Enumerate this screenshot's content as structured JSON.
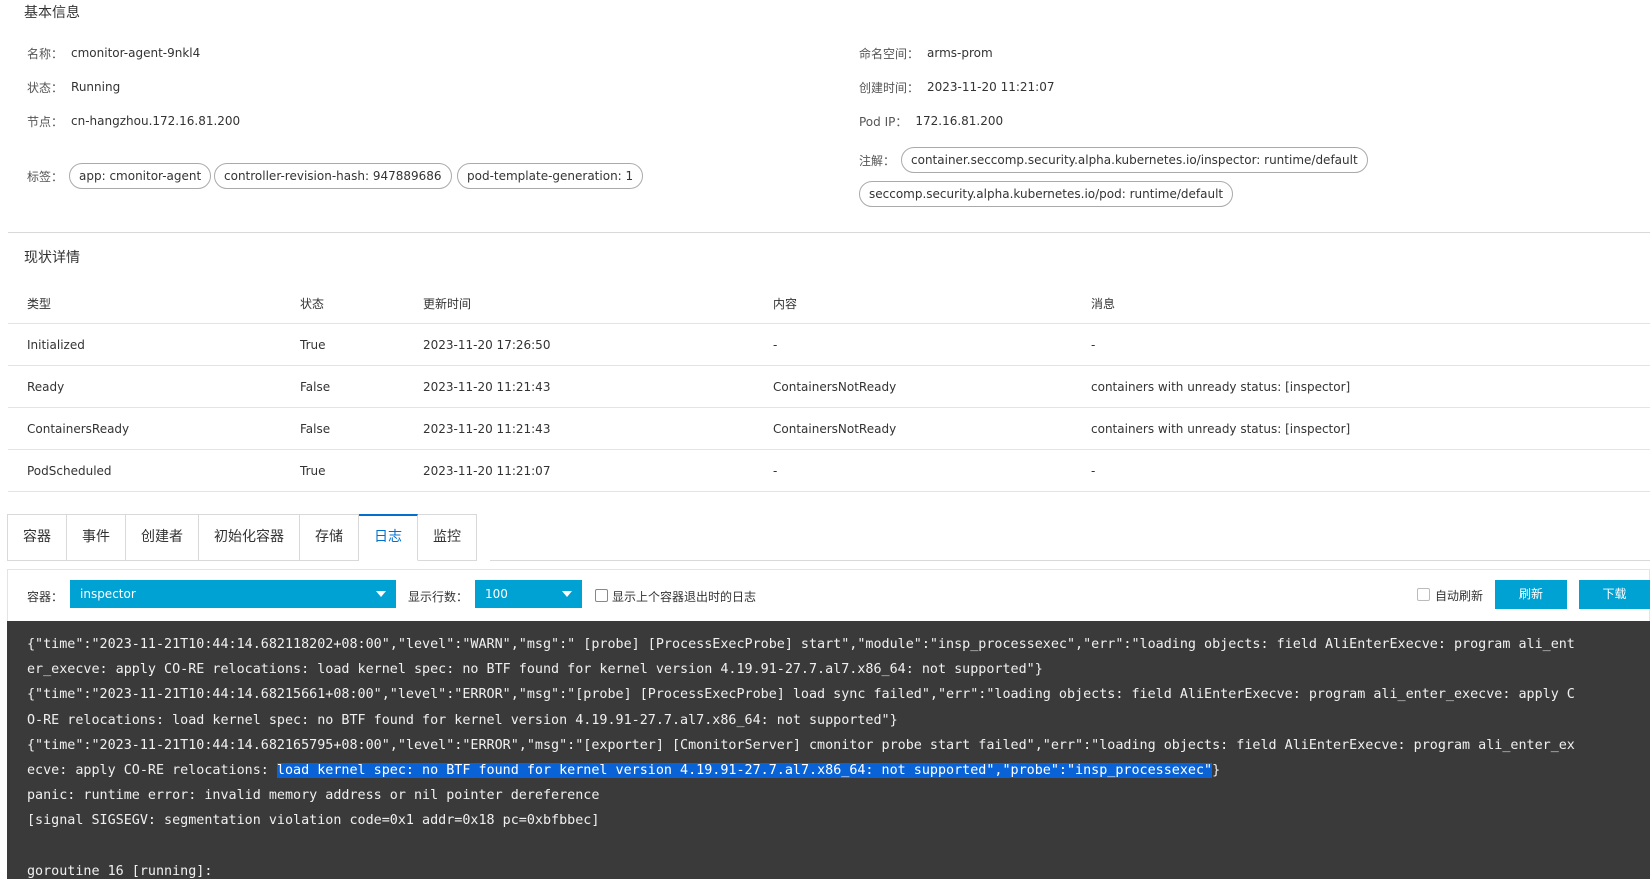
{
  "basic_info": {
    "title": "基本信息",
    "name_label": "名称：",
    "name_value": "cmonitor-agent-9nkl4",
    "namespace_label": "命名空间：",
    "namespace_value": "arms-prom",
    "status_label": "状态：",
    "status_value": "Running",
    "created_label": "创建时间：",
    "created_value": "2023-11-20 11:21:07",
    "node_label": "节点：",
    "node_value": "cn-hangzhou.172.16.81.200",
    "podip_label": "Pod IP：",
    "podip_value": "172.16.81.200",
    "labels_label": "标签：",
    "labels": [
      "app: cmonitor-agent",
      "controller-revision-hash: 947889686",
      "pod-template-generation: 1"
    ],
    "annotations_label": "注解：",
    "annotations": [
      "container.seccomp.security.alpha.kubernetes.io/inspector: runtime/default",
      "seccomp.security.alpha.kubernetes.io/pod: runtime/default"
    ]
  },
  "status_details": {
    "title": "现状详情",
    "columns": [
      "类型",
      "状态",
      "更新时间",
      "内容",
      "消息"
    ],
    "rows": [
      [
        "Initialized",
        "True",
        "2023-11-20 17:26:50",
        "-",
        "-"
      ],
      [
        "Ready",
        "False",
        "2023-11-20 11:21:43",
        "ContainersNotReady",
        "containers with unready status: [inspector]"
      ],
      [
        "ContainersReady",
        "False",
        "2023-11-20 11:21:43",
        "ContainersNotReady",
        "containers with unready status: [inspector]"
      ],
      [
        "PodScheduled",
        "True",
        "2023-11-20 11:21:07",
        "-",
        "-"
      ]
    ]
  },
  "tabs": [
    "容器",
    "事件",
    "创建者",
    "初始化容器",
    "存储",
    "日志",
    "监控"
  ],
  "active_tab": "日志",
  "log_panel": {
    "container_label": "容器：",
    "container_value": "inspector",
    "lines_label": "显示行数：",
    "lines_value": "100",
    "prev_container_label": "显示上个容器退出时的日志",
    "auto_refresh_label": "自动刷新",
    "refresh_button": "刷新",
    "download_button": "下载"
  },
  "log": {
    "line1": "{\"time\":\"2023-11-21T10:44:14.682118202+08:00\",\"level\":\"WARN\",\"msg\":\" [probe] [ProcessExecProbe] start\",\"module\":\"insp_processexec\",\"err\":\"loading objects: field AliEnterExecve: program ali_ent",
    "line2": "er_execve: apply CO-RE relocations: load kernel spec: no BTF found for kernel version 4.19.91-27.7.al7.x86_64: not supported\"}",
    "line3": "{\"time\":\"2023-11-21T10:44:14.68215661+08:00\",\"level\":\"ERROR\",\"msg\":\"[probe] [ProcessExecProbe] load sync failed\",\"err\":\"loading objects: field AliEnterExecve: program ali_enter_execve: apply C",
    "line4": "O-RE relocations: load kernel spec: no BTF found for kernel version 4.19.91-27.7.al7.x86_64: not supported\"}",
    "line5": "{\"time\":\"2023-11-21T10:44:14.682165795+08:00\",\"level\":\"ERROR\",\"msg\":\"[exporter] [CmonitorServer] cmonitor probe start failed\",\"err\":\"loading objects: field AliEnterExecve: program ali_enter_ex",
    "line6_pre": "ecve: apply CO-RE relocations: ",
    "line6_hl": "load kernel spec: no BTF found for kernel version 4.19.91-27.7.al7.x86_64: not supported\",\"probe\":\"insp_processexec\"",
    "line6_post": "}",
    "line7": "panic: runtime error: invalid memory address or nil pointer dereference",
    "line8": "[signal SIGSEGV: segmentation violation code=0x1 addr=0x18 pc=0xbfbbec]",
    "line9": "",
    "line10": "goroutine 16 [running]:"
  },
  "colors": {
    "accent": "#00a2d4",
    "active_tab": "#0070cc",
    "log_bg": "#3a3a3a",
    "selection": "#0a63d6"
  }
}
